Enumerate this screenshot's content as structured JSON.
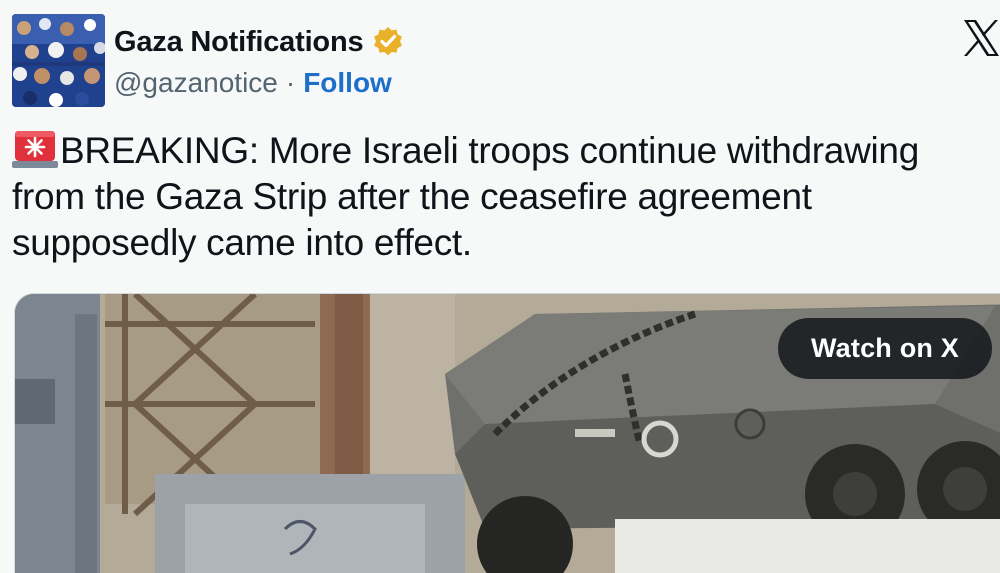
{
  "author": {
    "display_name": "Gaza Notifications",
    "handle": "@gazanotice",
    "separator": "·",
    "follow_label": "Follow",
    "verified": true,
    "verified_color": "#e8b129"
  },
  "platform": {
    "logo_icon": "x-logo-icon"
  },
  "tweet": {
    "emoji_icon": "police-siren-icon",
    "text": "BREAKING: More Israeli troops continue withdrawing from the Gaza Strip after the ceasefire agreement supposedly came into effect."
  },
  "media": {
    "watch_label": "Watch on X"
  },
  "colors": {
    "background": "#f7f9f9",
    "text": "#0f1419",
    "secondary_text": "#536471",
    "link": "#1d6fc9",
    "pill_background": "#0f1419"
  }
}
